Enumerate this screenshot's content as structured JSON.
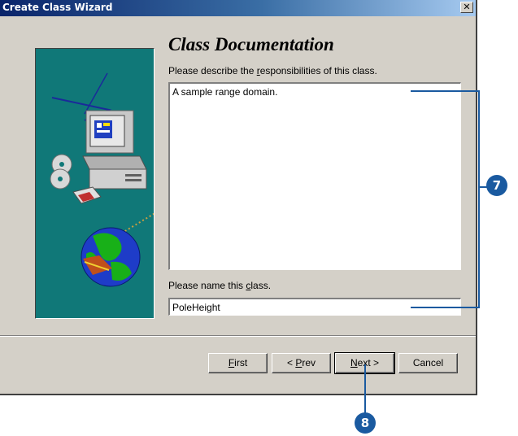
{
  "window": {
    "title": "Create Class Wizard",
    "close_glyph": "✕"
  },
  "page": {
    "title": "Class Documentation",
    "description_prompt_pre": "Please describe the ",
    "description_prompt_ul": "r",
    "description_prompt_post": "esponsibilities of this class.",
    "description_value": "A sample range domain.",
    "name_prompt_pre": "Please name this ",
    "name_prompt_ul": "c",
    "name_prompt_post": "lass.",
    "name_value": "PoleHeight"
  },
  "buttons": {
    "first_ul": "F",
    "first_rest": "irst",
    "prev_pre": "< ",
    "prev_ul": "P",
    "prev_rest": "rev",
    "next_ul": "N",
    "next_rest": "ext >",
    "cancel": "Cancel"
  },
  "callouts": {
    "step7": "7",
    "step8": "8"
  },
  "colors": {
    "title_bar_start": "#0a246a",
    "title_bar_end": "#a6caf0",
    "dialog_bg": "#d4d0c8",
    "side_panel": "#107878",
    "callout": "#1a5aa0"
  },
  "icons": {
    "side_illustration": "computer-globe-illustration"
  }
}
